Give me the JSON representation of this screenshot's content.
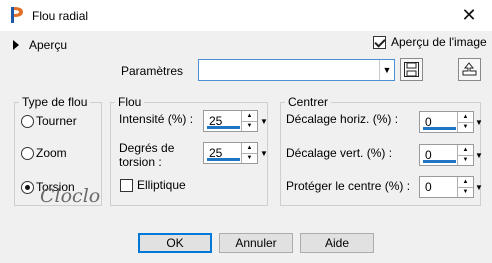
{
  "window": {
    "title": "Flou radial"
  },
  "header": {
    "preview_toggle_label": "Aperçu",
    "image_preview_label": "Aperçu de l'image",
    "image_preview_checked": true
  },
  "params": {
    "label": "Paramètres",
    "value": ""
  },
  "blur_type": {
    "title": "Type de flou",
    "options": [
      {
        "label": "Tourner",
        "selected": false
      },
      {
        "label": "Zoom",
        "selected": false
      },
      {
        "label": "Torsion",
        "selected": true
      }
    ]
  },
  "blur": {
    "title": "Flou",
    "intensity_label": "Intensité (%) :",
    "intensity_value": "25",
    "twist_label_line1": "Degrés de",
    "twist_label_line2": "torsion :",
    "twist_value": "25",
    "elliptical_label": "Elliptique",
    "elliptical_checked": false
  },
  "center": {
    "title": "Centrer",
    "h_offset_label": "Décalage horiz. (%) :",
    "h_offset_value": "0",
    "v_offset_label": "Décalage vert. (%) :",
    "v_offset_value": "0",
    "protect_label": "Protéger le centre (%) :",
    "protect_value": "0"
  },
  "watermark": {
    "text": "Cloclo"
  },
  "buttons": {
    "ok": "OK",
    "cancel": "Annuler",
    "help": "Aide"
  },
  "colors": {
    "accent": "#1f74c4",
    "focus_border": "#0078d7"
  }
}
